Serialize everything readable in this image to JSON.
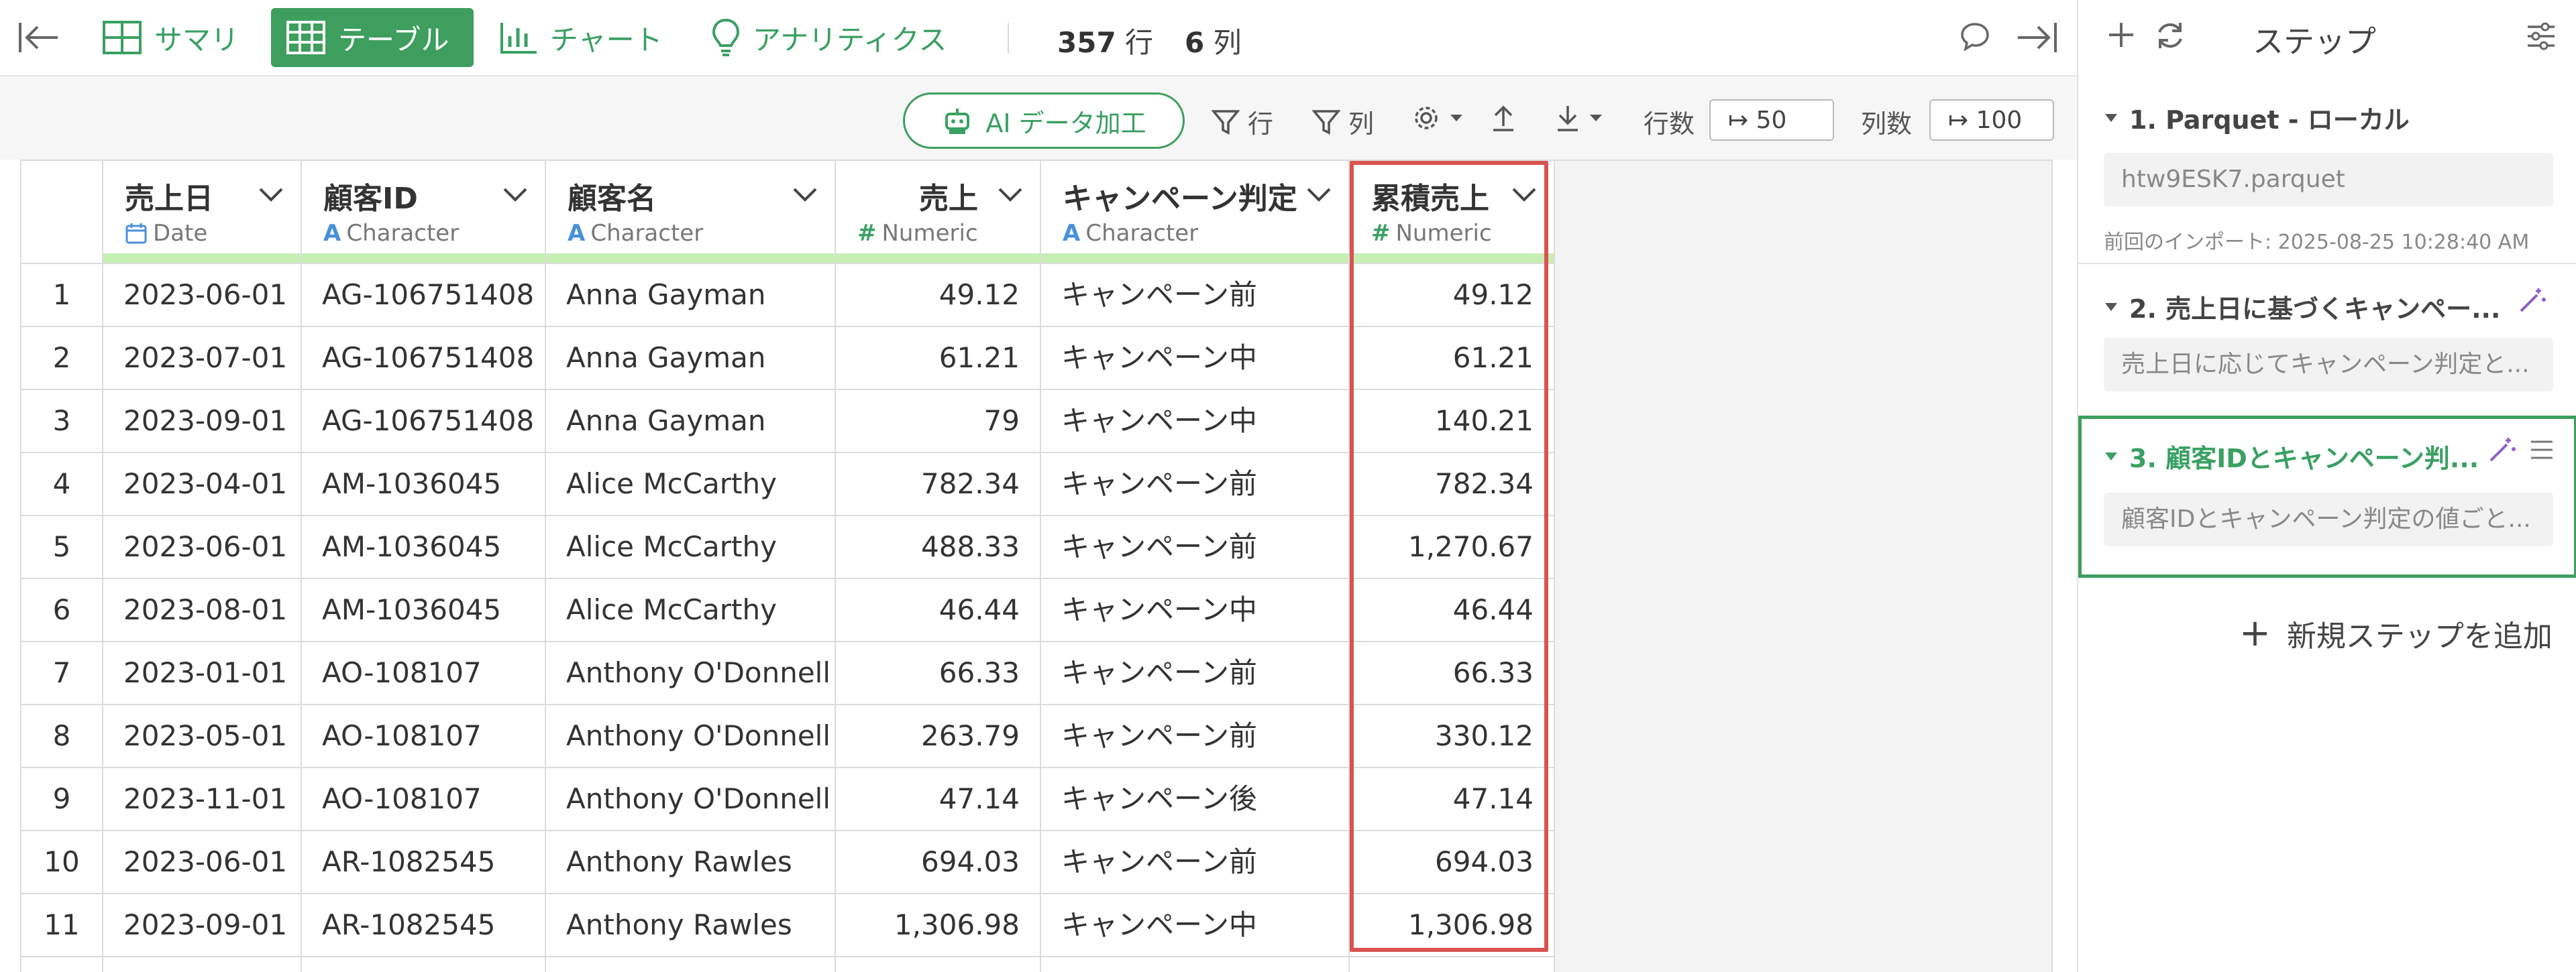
{
  "nav": {
    "summary_label": "サマリ",
    "table_label": "テーブル",
    "chart_label": "チャート",
    "analytics_label": "アナリティクス",
    "rows_count": "357",
    "rows_unit": "行",
    "cols_count": "6",
    "cols_unit": "列"
  },
  "toolbar": {
    "ai_label": "AI データ加工",
    "row_filter_label": "行",
    "col_filter_label": "列",
    "rows_label": "行数",
    "rows_value": "↦ 50",
    "cols_label": "列数",
    "cols_value": "↦ 100"
  },
  "columns": [
    {
      "name": "売上日",
      "type": "Date",
      "type_icon": "calendar-icon"
    },
    {
      "name": "顧客ID",
      "type": "Character",
      "type_icon": "A"
    },
    {
      "name": "顧客名",
      "type": "Character",
      "type_icon": "A"
    },
    {
      "name": "売上",
      "type": "Numeric",
      "type_icon": "#"
    },
    {
      "name": "キャンペーン判定",
      "type": "Character",
      "type_icon": "A"
    },
    {
      "name": "累積売上",
      "type": "Numeric",
      "type_icon": "#"
    }
  ],
  "rows": [
    {
      "idx": "1",
      "date": "2023-06-01",
      "cid": "AG-106751408",
      "cname": "Anna Gayman",
      "sales": "49.12",
      "camp": "キャンペーン前",
      "cum": "49.12"
    },
    {
      "idx": "2",
      "date": "2023-07-01",
      "cid": "AG-106751408",
      "cname": "Anna Gayman",
      "sales": "61.21",
      "camp": "キャンペーン中",
      "cum": "61.21"
    },
    {
      "idx": "3",
      "date": "2023-09-01",
      "cid": "AG-106751408",
      "cname": "Anna Gayman",
      "sales": "79",
      "camp": "キャンペーン中",
      "cum": "140.21"
    },
    {
      "idx": "4",
      "date": "2023-04-01",
      "cid": "AM-1036045",
      "cname": "Alice McCarthy",
      "sales": "782.34",
      "camp": "キャンペーン前",
      "cum": "782.34"
    },
    {
      "idx": "5",
      "date": "2023-06-01",
      "cid": "AM-1036045",
      "cname": "Alice McCarthy",
      "sales": "488.33",
      "camp": "キャンペーン前",
      "cum": "1,270.67"
    },
    {
      "idx": "6",
      "date": "2023-08-01",
      "cid": "AM-1036045",
      "cname": "Alice McCarthy",
      "sales": "46.44",
      "camp": "キャンペーン中",
      "cum": "46.44"
    },
    {
      "idx": "7",
      "date": "2023-01-01",
      "cid": "AO-108107",
      "cname": "Anthony O'Donnell",
      "sales": "66.33",
      "camp": "キャンペーン前",
      "cum": "66.33"
    },
    {
      "idx": "8",
      "date": "2023-05-01",
      "cid": "AO-108107",
      "cname": "Anthony O'Donnell",
      "sales": "263.79",
      "camp": "キャンペーン前",
      "cum": "330.12"
    },
    {
      "idx": "9",
      "date": "2023-11-01",
      "cid": "AO-108107",
      "cname": "Anthony O'Donnell",
      "sales": "47.14",
      "camp": "キャンペーン後",
      "cum": "47.14"
    },
    {
      "idx": "10",
      "date": "2023-06-01",
      "cid": "AR-1082545",
      "cname": "Anthony Rawles",
      "sales": "694.03",
      "camp": "キャンペーン前",
      "cum": "694.03"
    },
    {
      "idx": "11",
      "date": "2023-09-01",
      "cid": "AR-1082545",
      "cname": "Anthony Rawles",
      "sales": "1,306.98",
      "camp": "キャンペーン中",
      "cum": "1,306.98"
    }
  ],
  "steps_panel": {
    "title": "ステップ",
    "steps": [
      {
        "title": "1. Parquet - ローカル",
        "box": "htw9ESK7.parquet",
        "meta": "前回のインポート: 2025-08-25 10:28:40 AM"
      },
      {
        "title": "2. 売上日に基づくキャンペー...",
        "box": "売上日に応じてキャンペーン判定と..."
      },
      {
        "title": "3. 顧客IDとキャンペーン判...",
        "box": "顧客IDとキャンペーン判定の値ごと..."
      }
    ],
    "add_label": "新規ステップを追加"
  },
  "colors": {
    "accent": "#3e9e5e",
    "highlight": "#d9534f",
    "type_icon": "#4a90d9",
    "step_magic": "#8e5cc7"
  }
}
